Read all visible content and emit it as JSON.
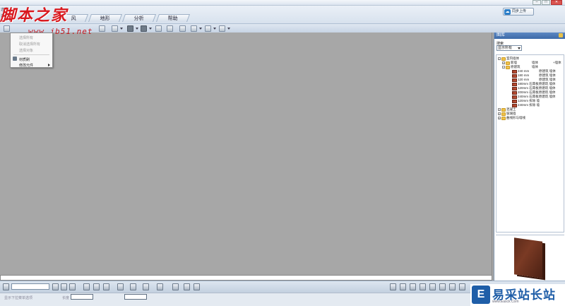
{
  "window": {
    "title": "",
    "controls": [
      "–",
      "□",
      "✕"
    ]
  },
  "ribbon": {
    "side_labels": [
      "选择",
      "选择动"
    ],
    "tabs": [
      "风",
      "地形",
      "分析",
      "帮助"
    ],
    "cloud_button": "同步上传"
  },
  "watermark": {
    "site_name": "脚本之家",
    "site_url": "www.jb51.net",
    "corner_name": "易采站长站",
    "corner_url": "www.Easck.Com"
  },
  "context_menu": {
    "items": [
      {
        "label": "选择所有",
        "enabled": false
      },
      {
        "label": "取消选择所有",
        "enabled": false
      },
      {
        "label": "选择对象",
        "enabled": false
      },
      {
        "label": "材质刷",
        "enabled": true
      },
      {
        "label": "修改元件",
        "enabled": true,
        "submenu": true
      }
    ]
  },
  "panel": {
    "title": "图库",
    "search_label": "搜索",
    "filter": "显示所有",
    "tree": [
      {
        "level": 0,
        "label": "室内墙体",
        "extra": ""
      },
      {
        "level": 1,
        "label": "新墙",
        "col2": "墙体",
        "col3": "+墙体"
      },
      {
        "level": 1,
        "label": "原建筑",
        "col2": "墙体",
        "col3": ""
      },
      {
        "level": 2,
        "label": "240 mm",
        "col2": "原建筑 墙体"
      },
      {
        "level": 2,
        "label": "180 mm",
        "col2": "原建筑 墙体"
      },
      {
        "level": 2,
        "label": "120 mm",
        "col2": "原建筑 墙体"
      },
      {
        "level": 2,
        "label": "180mm 石膏板原建筑 墙体",
        "col2": ""
      },
      {
        "level": 2,
        "label": "120mm 石膏板原建筑 墙体",
        "col2": ""
      },
      {
        "level": 2,
        "label": "200mm 石膏板原建筑 墙体",
        "col2": ""
      },
      {
        "level": 2,
        "label": "240mm 石膏板原建筑 墙体",
        "col2": ""
      },
      {
        "level": 2,
        "label": "120mm 拆除 墙",
        "col2": ""
      },
      {
        "level": 2,
        "label": "240mm 拆除 墙",
        "col2": ""
      },
      {
        "level": 0,
        "label": "混凝土",
        "extra": ""
      },
      {
        "level": 0,
        "label": "玻璃墙",
        "extra": ""
      },
      {
        "level": 0,
        "label": "曲线形与墙线",
        "extra": ""
      }
    ]
  },
  "status": {
    "hint": "显示下拉菜单选项",
    "field_label": "长度"
  }
}
